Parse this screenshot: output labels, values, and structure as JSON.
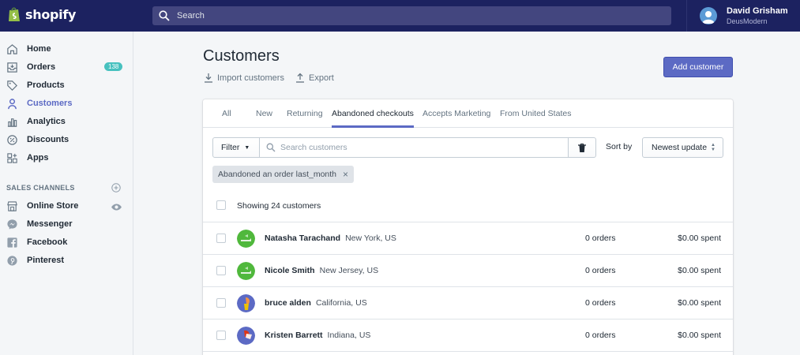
{
  "brand": {
    "name": "shopify"
  },
  "topbar": {
    "search_placeholder": "Search",
    "user": {
      "name": "David Grisham",
      "store": "DeusModern"
    }
  },
  "sidebar": {
    "items": [
      {
        "label": "Home",
        "icon": "home-icon"
      },
      {
        "label": "Orders",
        "icon": "orders-icon",
        "badge": "138"
      },
      {
        "label": "Products",
        "icon": "tag-icon"
      },
      {
        "label": "Customers",
        "icon": "person-icon",
        "active": true
      },
      {
        "label": "Analytics",
        "icon": "bar-chart-icon"
      },
      {
        "label": "Discounts",
        "icon": "discount-icon"
      },
      {
        "label": "Apps",
        "icon": "apps-icon"
      }
    ],
    "sales_channels_label": "SALES CHANNELS",
    "channels": [
      {
        "label": "Online Store",
        "icon": "store-icon"
      },
      {
        "label": "Messenger",
        "icon": "messenger-icon"
      },
      {
        "label": "Facebook",
        "icon": "facebook-icon"
      },
      {
        "label": "Pinterest",
        "icon": "pinterest-icon"
      }
    ]
  },
  "page": {
    "title": "Customers",
    "import_label": "Import customers",
    "export_label": "Export",
    "add_button": "Add customer"
  },
  "tabs": [
    "All",
    "New",
    "Returning",
    "Abandoned checkouts",
    "Accepts Marketing",
    "From United States"
  ],
  "selected_tab": "Abandoned checkouts",
  "filter": {
    "button_label": "Filter",
    "search_placeholder": "Search customers",
    "sort_label": "Sort by",
    "sort_value": "Newest update",
    "applied_tag": "Abandoned an order last_month"
  },
  "list": {
    "showing_text": "Showing 24 customers",
    "customers": [
      {
        "name": "Natasha Tarachand",
        "location": "New York, US",
        "orders": "0 orders",
        "spent": "$0.00 spent",
        "avatar_color": "#50b83c"
      },
      {
        "name": "Nicole Smith",
        "location": "New Jersey, US",
        "orders": "0 orders",
        "spent": "$0.00 spent",
        "avatar_color": "#50b83c"
      },
      {
        "name": "bruce alden",
        "location": "California, US",
        "orders": "0 orders",
        "spent": "$0.00 spent",
        "avatar_color": "#5c6ac4"
      },
      {
        "name": "Kristen Barrett",
        "location": "Indiana, US",
        "orders": "0 orders",
        "spent": "$0.00 spent",
        "avatar_color": "#5c6ac4"
      }
    ]
  },
  "colors": {
    "topbar": "#1c2260",
    "accent": "#5c6ac4",
    "badge": "#47c1bf"
  }
}
